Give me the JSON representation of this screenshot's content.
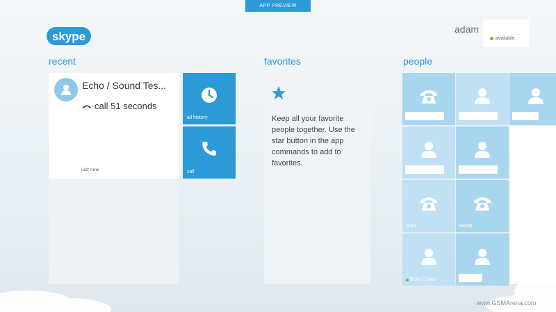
{
  "banner": {
    "label": "APP PREVIEW"
  },
  "brand": {
    "logo": "skype",
    "accent": "#2b9ad6"
  },
  "user": {
    "name": "adam",
    "status": "available",
    "status_color": "#6abf3b"
  },
  "sections": {
    "recent": "recent",
    "favorites": "favorites",
    "people": "people"
  },
  "recent": {
    "contact": "Echo / Sound Tes...",
    "call_text": "call 51 seconds",
    "time": "just now",
    "avatar_icon": "person-icon"
  },
  "actions": [
    {
      "label": "all history",
      "icon": "clock-icon"
    },
    {
      "label": "call",
      "icon": "phone-icon"
    }
  ],
  "favorites": {
    "icon": "star-icon",
    "message": "Keep all your favorite people together. Use the star button in the app commands to add to favorites."
  },
  "people": [
    {
      "icon": "phone-icon",
      "label": ""
    },
    {
      "icon": "person-icon",
      "label": ""
    },
    {
      "icon": "person-icon",
      "label": ""
    },
    {
      "icon": "person-icon",
      "label": ""
    },
    {
      "icon": "person-icon",
      "label": ""
    },
    {
      "icon": "phone-icon",
      "label": "Start"
    },
    {
      "icon": "phone-icon",
      "label": "Home"
    },
    {
      "icon": "person-icon",
      "label": "Echo / Soun"
    },
    {
      "icon": "person-icon",
      "label": ""
    }
  ],
  "watermark": "www.GSMArena.com"
}
